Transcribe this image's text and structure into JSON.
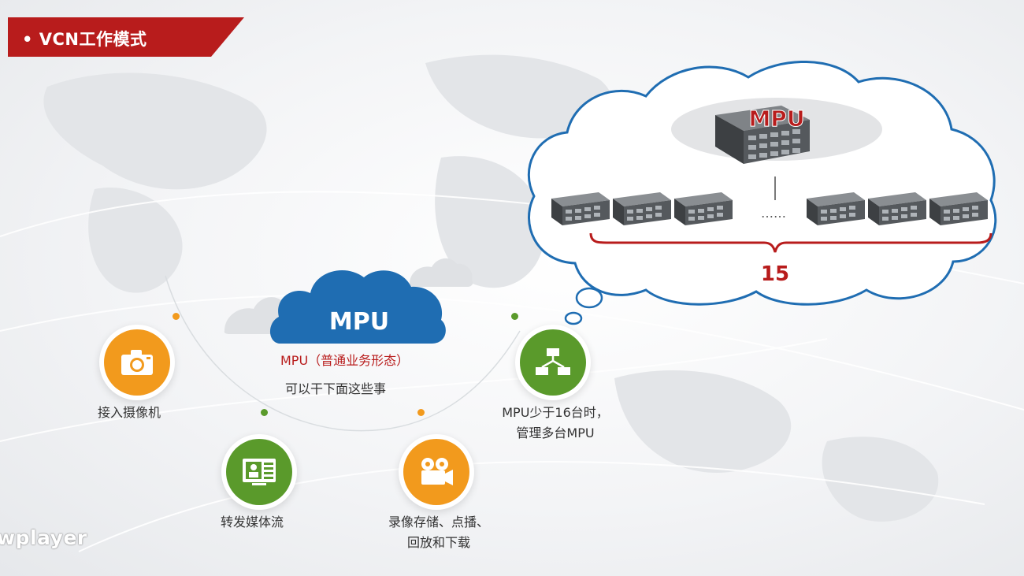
{
  "header": {
    "title": "• VCN工作模式"
  },
  "center_cloud": {
    "title": "MPU",
    "subtitle": "MPU（普通业务形态）",
    "description": "可以干下面这些事"
  },
  "functions": [
    {
      "icon": "camera-icon",
      "label": "接入摄像机"
    },
    {
      "icon": "media-stream-icon",
      "label": "转发媒体流"
    },
    {
      "icon": "video-camera-icon",
      "label_line1": "录像存储、点播、",
      "label_line2": "回放和下载"
    },
    {
      "icon": "network-tree-icon",
      "label_line1": "MPU少于16台时，",
      "label_line2": "管理多台MPU"
    }
  ],
  "thought_cloud": {
    "master_label": "MPU",
    "ellipsis": "……",
    "count": "15"
  },
  "watermark": "wplayer",
  "colors": {
    "brand_red": "#b81c1c",
    "cloud_blue": "#1f6db2",
    "orange": "#f29a1d",
    "green": "#5a9a2b"
  }
}
